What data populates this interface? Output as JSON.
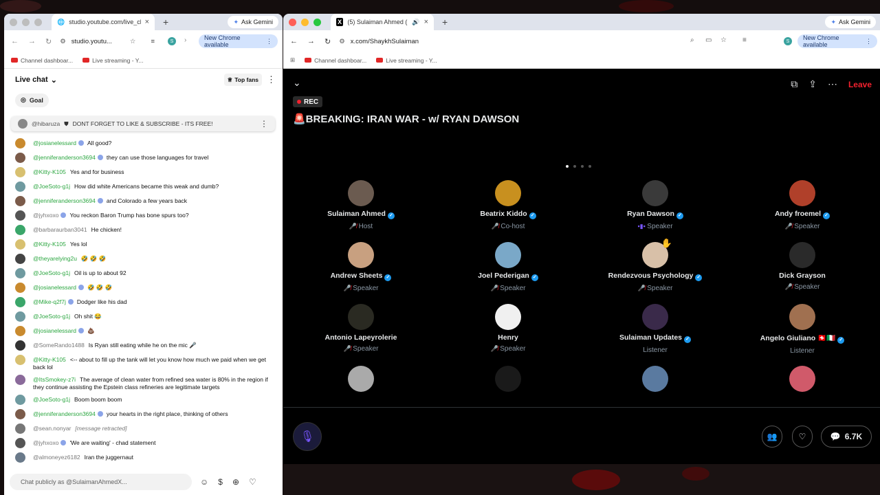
{
  "left_window": {
    "tab_title": "studio.youtube.com/live_cha",
    "ask_gemini": "Ask Gemini",
    "url": "studio.youtu...",
    "new_chrome": "New Chrome available",
    "profile": "S",
    "bookmarks": [
      "Channel dashboar...",
      "Live streaming - Y..."
    ]
  },
  "right_window": {
    "tab_title": "(5) Sulaiman Ahmed (@S",
    "ask_gemini": "Ask Gemini",
    "url": "x.com/ShaykhSulaiman",
    "new_chrome": "New Chrome available",
    "profile": "S",
    "bookmarks": [
      "Channel dashboar...",
      "Live streaming - Y..."
    ]
  },
  "chat": {
    "header": "Live chat",
    "top_fans": "Top fans",
    "goal": "Goal",
    "pinned_author": "@hibaruza",
    "pinned_text": "DONT FORGET TO LIKE & SUBSCRIBE - ITS FREE!",
    "input_placeholder": "Chat publicly as @SulaimanAhmedX...",
    "messages": [
      {
        "author": "@josianelessard",
        "text": "All good?",
        "member": true,
        "badge": true,
        "avatar_color": "#c98a2e"
      },
      {
        "author": "@jenniferanderson3694",
        "text": "they can use those languages for travel",
        "member": true,
        "badge": true,
        "avatar_color": "#7b5b4a"
      },
      {
        "author": "@Kitty-K105",
        "text": "Yes and for business",
        "member": true,
        "badge": false,
        "avatar_color": "#d8c070"
      },
      {
        "author": "@JoeSoto-g1j",
        "text": "How did white Americans became this weak and dumb?",
        "member": true,
        "badge": false,
        "avatar_color": "#6f9aa0"
      },
      {
        "author": "@jenniferanderson3694",
        "text": "and Colorado a few years back",
        "member": true,
        "badge": true,
        "avatar_color": "#7b5b4a"
      },
      {
        "author": "@jyhxoxo",
        "text": "You reckon Baron Trump has bone spurs too?",
        "member": false,
        "badge": true,
        "avatar_color": "#555555"
      },
      {
        "author": "@barbaraurban3041",
        "text": "He chicken!",
        "member": false,
        "badge": false,
        "avatar_color": "#3aa66a"
      },
      {
        "author": "@Kitty-K105",
        "text": "Yes lol",
        "member": true,
        "badge": false,
        "avatar_color": "#d8c070"
      },
      {
        "author": "@theyarelying2u",
        "text": "🤣 🤣 🤣",
        "member": true,
        "badge": false,
        "avatar_color": "#444444"
      },
      {
        "author": "@JoeSoto-g1j",
        "text": "Oil is up to about 92",
        "member": true,
        "badge": false,
        "avatar_color": "#6f9aa0"
      },
      {
        "author": "@josianelessard",
        "text": "🤣 🤣 🤣",
        "member": true,
        "badge": true,
        "avatar_color": "#c98a2e"
      },
      {
        "author": "@Mike-q2f7j",
        "text": "Dodger like his dad",
        "member": true,
        "badge": true,
        "avatar_color": "#3aa66a"
      },
      {
        "author": "@JoeSoto-g1j",
        "text": "Oh shit 😂",
        "member": true,
        "badge": false,
        "avatar_color": "#6f9aa0"
      },
      {
        "author": "@josianelessard",
        "text": "💩",
        "member": true,
        "badge": true,
        "avatar_color": "#c98a2e"
      },
      {
        "author": "@SomeRando1488",
        "text": "Is Ryan still eating while he on the mic 🎤",
        "member": false,
        "badge": false,
        "avatar_color": "#333333"
      },
      {
        "author": "@Kitty-K105",
        "text": "<-- about to fill up the tank will let you know how much we paid when we get back lol",
        "member": true,
        "badge": false,
        "avatar_color": "#d8c070"
      },
      {
        "author": "@ItsSmokey-z7i",
        "text": "The average of clean water from refined sea water is 80% in the region if they continue assisting the Epstein class refineries are legitimate targets",
        "member": true,
        "badge": false,
        "avatar_color": "#8a6a9a"
      },
      {
        "author": "@JoeSoto-g1j",
        "text": "Boom boom boom",
        "member": true,
        "badge": false,
        "avatar_color": "#6f9aa0"
      },
      {
        "author": "@jenniferanderson3694",
        "text": "your hearts in the right place, thinking of others",
        "member": true,
        "badge": true,
        "avatar_color": "#7b5b4a"
      },
      {
        "author": "@sean.nonyar",
        "text": "[message retracted]",
        "member": false,
        "badge": false,
        "avatar_color": "#777777",
        "retracted": true
      },
      {
        "author": "@jyhxoxo",
        "text": "'We are waiting' - chad statement",
        "member": false,
        "badge": true,
        "avatar_color": "#555555"
      },
      {
        "author": "@almoneyez6182",
        "text": "Iran the juggernaut",
        "member": false,
        "badge": false,
        "avatar_color": "#6a7a8a"
      }
    ]
  },
  "space": {
    "rec": "REC",
    "title": "🚨BREAKING: IRAN WAR - w/ RYAN DAWSON",
    "leave": "Leave",
    "comments_count": "6.7K",
    "participants": [
      {
        "name": "Sulaiman Ahmed",
        "role": "Host",
        "verified": true,
        "role_icon": "mic-off",
        "color": "#6b5b50"
      },
      {
        "name": "Beatrix Kiddo",
        "role": "Co-host",
        "verified": true,
        "role_icon": "mic-off",
        "color": "#c8901f"
      },
      {
        "name": "Ryan Dawson",
        "role": "Speaker",
        "verified": true,
        "role_icon": "speaking",
        "color": "#3a3a3a"
      },
      {
        "name": "Andy froemel",
        "role": "Speaker",
        "verified": true,
        "role_icon": "mic-off",
        "color": "#b0402a"
      },
      {
        "name": "Andrew Sheets",
        "role": "Speaker",
        "verified": true,
        "role_icon": "mic-off",
        "color": "#c8a080"
      },
      {
        "name": "Joel Pederigan",
        "role": "Speaker",
        "verified": true,
        "role_icon": "mic-off",
        "color": "#7aa8c8"
      },
      {
        "name": "Rendezvous Psychology",
        "role": "Speaker",
        "verified": true,
        "role_icon": "mic-off",
        "color": "#d8c0a8",
        "hand": true
      },
      {
        "name": "Dick Grayson",
        "role": "Speaker",
        "verified": false,
        "role_icon": "mic-off",
        "color": "#2a2a2a"
      },
      {
        "name": "Antonio Lapeyrolerie",
        "role": "Speaker",
        "verified": false,
        "role_icon": "mic-off",
        "color": "#2a2a22"
      },
      {
        "name": "Henry",
        "role": "Speaker",
        "verified": false,
        "role_icon": "mic-off",
        "color": "#f0f0f0"
      },
      {
        "name": "Sulaiman Updates",
        "role": "Listener",
        "verified": true,
        "role_icon": "none",
        "color": "#3a2a4a"
      },
      {
        "name": "Angelo Giuliano 🇨🇭🇮🇹",
        "role": "Listener",
        "verified": true,
        "role_icon": "none",
        "color": "#a07050"
      },
      {
        "name": "",
        "role": "",
        "verified": false,
        "role_icon": "none",
        "color": "#aaaaaa"
      },
      {
        "name": "",
        "role": "",
        "verified": false,
        "role_icon": "none",
        "color": "#1a1a1a"
      },
      {
        "name": "",
        "role": "",
        "verified": false,
        "role_icon": "none",
        "color": "#5a7aa0"
      },
      {
        "name": "",
        "role": "",
        "verified": false,
        "role_icon": "none",
        "color": "#d05a6a"
      }
    ]
  }
}
